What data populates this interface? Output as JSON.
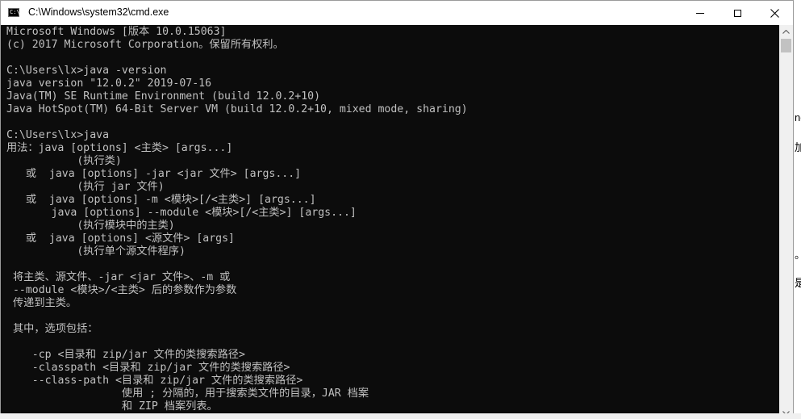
{
  "window": {
    "title": "C:\\Windows\\system32\\cmd.exe",
    "icon_name": "cmd-icon",
    "icon_label": "C:\\"
  },
  "console": {
    "foreground": "#c0c0c0",
    "background": "#0c0c0c",
    "lines": [
      "Microsoft Windows [版本 10.0.15063]",
      "(c) 2017 Microsoft Corporation。保留所有权利。",
      "",
      "C:\\Users\\lx>java -version",
      "java version \"12.0.2\" 2019-07-16",
      "Java(TM) SE Runtime Environment (build 12.0.2+10)",
      "Java HotSpot(TM) 64-Bit Server VM (build 12.0.2+10, mixed mode, sharing)",
      "",
      "C:\\Users\\lx>java",
      "用法：java [options] <主类> [args...]",
      "           (执行类)",
      "   或  java [options] -jar <jar 文件> [args...]",
      "           (执行 jar 文件)",
      "   或  java [options] -m <模块>[/<主类>] [args...]",
      "       java [options] --module <模块>[/<主类>] [args...]",
      "           (执行模块中的主类)",
      "   或  java [options] <源文件> [args]",
      "           (执行单个源文件程序)",
      "",
      " 将主类、源文件、-jar <jar 文件>、-m 或",
      " --module <模块>/<主类> 后的参数作为参数",
      " 传递到主类。",
      "",
      " 其中，选项包括：",
      "",
      "    -cp <目录和 zip/jar 文件的类搜索路径>",
      "    -classpath <目录和 zip/jar 文件的类搜索路径>",
      "    --class-path <目录和 zip/jar 文件的类搜索路径>",
      "                  使用 ; 分隔的，用于搜索类文件的目录，JAR 档案",
      "                  和 ZIP 档案列表。"
    ]
  },
  "background_window": {
    "glyphs": [
      "ne",
      "加",
      "。",
      "是"
    ]
  }
}
